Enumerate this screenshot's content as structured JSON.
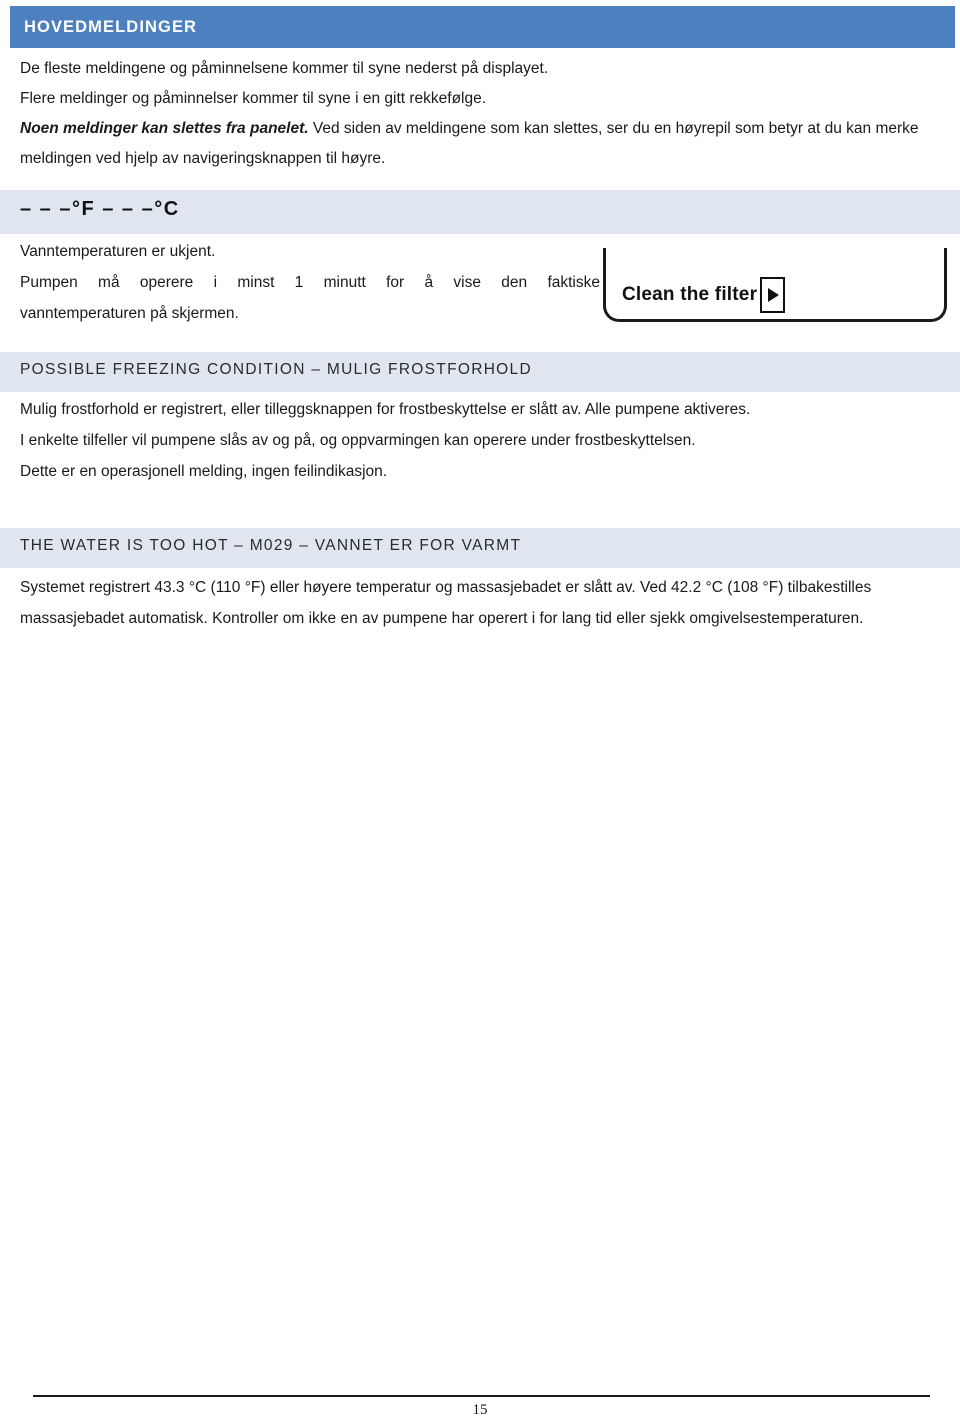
{
  "section": {
    "title": "HOVEDMELDINGER"
  },
  "intro": {
    "line1": "De fleste meldingene og påminnelsene kommer til syne nederst på displayet.",
    "line2": "Flere meldinger og påminnelser kommer til syne i en gitt rekkefølge.",
    "line3_bold": "Noen meldinger kan slettes fra panelet.",
    "line3_rest": " Ved siden av meldingene som kan slettes, ser du en høyrepil som betyr at du kan merke meldingen ved hjelp av navigeringsknappen til høyre."
  },
  "temp_band": {
    "value": "– – –°F – – –°C"
  },
  "temp_message": {
    "line1": "Vanntemperaturen er ukjent.",
    "line2": "Pumpen må operere i minst 1 minutt for å vise den faktiske",
    "line3": "vanntemperaturen på skjermen."
  },
  "lcd": {
    "label": "Clean the filter",
    "arrow_icon": "right-arrow-icon"
  },
  "messages": [
    {
      "heading": "POSSIBLE FREEZING CONDITION – MULIG FROSTFORHOLD",
      "paragraphs": [
        "Mulig frostforhold er registrert, eller tilleggsknappen for frostbeskyttelse er slått av. Alle pumpene aktiveres.",
        "I enkelte tilfeller vil pumpene slås av og på, og oppvarmingen kan operere under frostbeskyttelsen.",
        "Dette er en operasjonell melding, ingen feilindikasjon."
      ]
    },
    {
      "heading": "THE WATER IS TOO HOT – M029 – VANNET ER FOR VARMT",
      "paragraphs": [
        "Systemet registrert 43.3 °C (110 °F) eller høyere temperatur og massasjebadet er slått av. Ved 42.2 °C (108 °F) tilbakestilles massasjebadet automatisk. Kontroller om ikke en av pumpene har operert i for lang tid eller sjekk omgivelsestemperaturen."
      ]
    }
  ],
  "footer": {
    "page_number": "15"
  },
  "colors": {
    "header_blue": "#4d80bf",
    "band_light_blue": "#dfe6f0",
    "text": "#1a1a1a"
  }
}
